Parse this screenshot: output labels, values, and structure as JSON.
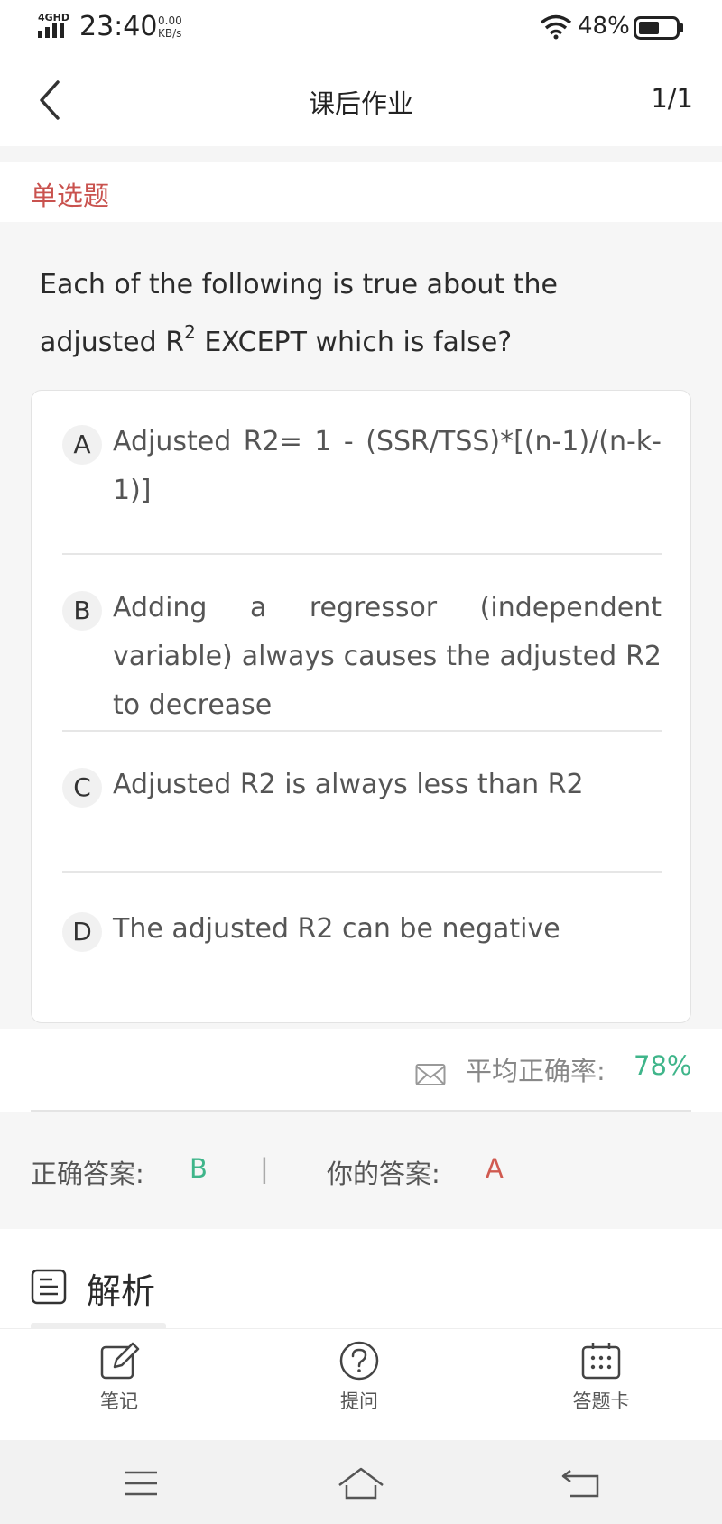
{
  "status_bar": {
    "network": "4GHD",
    "time": "23:40",
    "speed_value": "0.00",
    "speed_unit": "KB/s",
    "battery": "48%"
  },
  "nav": {
    "title": "课后作业",
    "counter": "1/1"
  },
  "question": {
    "type": "单选题",
    "stem_prefix": "Each of the following is true about the adjusted R",
    "stem_superscript": "2",
    "stem_suffix": " EXCEPT which is false?",
    "options": [
      {
        "letter": "A",
        "text": "Adjusted R2= 1 - (SSR/TSS)*[(n-1)/(n-k-1)]"
      },
      {
        "letter": "B",
        "text": "Adding a regressor (independent variable) always causes the adjusted R2 to decrease"
      },
      {
        "letter": "C",
        "text": "Adjusted R2 is always less than R2"
      },
      {
        "letter": "D",
        "text": "The adjusted R2 can be negative"
      }
    ]
  },
  "stats": {
    "label": "平均正确率:",
    "value": "78%"
  },
  "answer": {
    "correct_label": "正确答案:",
    "correct_value": "B",
    "separator": "|",
    "yours_label": "你的答案:",
    "yours_value": "A"
  },
  "analysis": {
    "heading": "解析"
  },
  "toolbar": {
    "notes": "笔记",
    "ask": "提问",
    "answer_card": "答题卡"
  },
  "colors": {
    "correct": "#3fb58a",
    "wrong": "#d05a50",
    "type_label": "#c9524e"
  },
  "icons": [
    "signal-icon",
    "wifi-icon",
    "battery-icon",
    "back-arrow-icon",
    "mail-icon",
    "document-icon",
    "edit-icon",
    "question-icon",
    "grid-card-icon",
    "menu-icon",
    "home-icon",
    "return-icon"
  ]
}
